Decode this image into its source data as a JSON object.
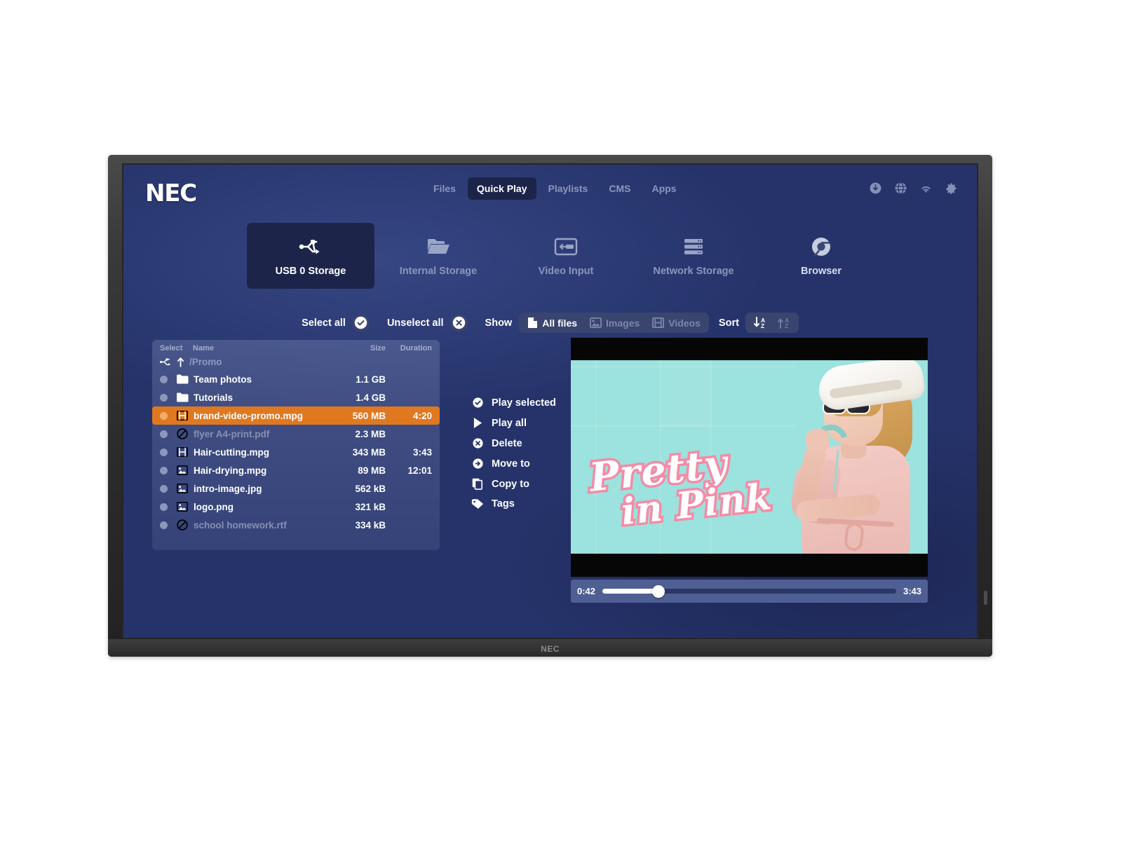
{
  "brand": {
    "logo": "NEC",
    "foot_logo": "NEC"
  },
  "topnav": {
    "items": [
      {
        "label": "Files",
        "active": false
      },
      {
        "label": "Quick Play",
        "active": true
      },
      {
        "label": "Playlists",
        "active": false
      },
      {
        "label": "CMS",
        "active": false
      },
      {
        "label": "Apps",
        "active": false
      }
    ]
  },
  "topicons": [
    {
      "name": "download-icon"
    },
    {
      "name": "globe-icon"
    },
    {
      "name": "wifi-icon"
    },
    {
      "name": "gear-icon"
    }
  ],
  "storage_tabs": [
    {
      "label": "USB 0 Storage",
      "icon": "usb-icon",
      "active": true
    },
    {
      "label": "Internal Storage",
      "icon": "folder-icon",
      "active": false
    },
    {
      "label": "Video Input",
      "icon": "video-input-icon",
      "active": false
    },
    {
      "label": "Network Storage",
      "icon": "server-icon",
      "active": false
    },
    {
      "label": "Browser",
      "icon": "chrome-icon",
      "active": false
    }
  ],
  "toolbar": {
    "select_all": "Select all",
    "unselect_all": "Unselect all",
    "show_label": "Show",
    "filters": [
      {
        "label": "All files",
        "icon": "document-icon",
        "active": true
      },
      {
        "label": "Images",
        "icon": "image-icon",
        "active": false
      },
      {
        "label": "Videos",
        "icon": "film-icon",
        "active": false
      }
    ],
    "sort_label": "Sort",
    "sort_buttons": [
      {
        "name": "sort-descending-az",
        "active": true
      },
      {
        "name": "sort-ascending-az",
        "active": false
      }
    ]
  },
  "filelist": {
    "columns": {
      "select": "Select",
      "name": "Name",
      "size": "Size",
      "duration": "Duration"
    },
    "path": "/Promo",
    "rows": [
      {
        "name": "Team photos",
        "size": "1.1 GB",
        "duration": "",
        "icon": "folder-icon",
        "selected": false,
        "disabled": false
      },
      {
        "name": "Tutorials",
        "size": "1.4 GB",
        "duration": "",
        "icon": "folder-icon",
        "selected": false,
        "disabled": false
      },
      {
        "name": "brand-video-promo.mpg",
        "size": "560 MB",
        "duration": "4:20",
        "icon": "film-icon",
        "selected": true,
        "disabled": false
      },
      {
        "name": "flyer A4-print.pdf",
        "size": "2.3 MB",
        "duration": "",
        "icon": "blocked-icon",
        "selected": false,
        "disabled": true
      },
      {
        "name": "Hair-cutting.mpg",
        "size": "343 MB",
        "duration": "3:43",
        "icon": "film-icon",
        "selected": false,
        "disabled": false
      },
      {
        "name": "Hair-drying.mpg",
        "size": "89 MB",
        "duration": "12:01",
        "icon": "image-icon",
        "selected": false,
        "disabled": false
      },
      {
        "name": "intro-image.jpg",
        "size": "562 kB",
        "duration": "",
        "icon": "image-icon",
        "selected": false,
        "disabled": false
      },
      {
        "name": "logo.png",
        "size": "321 kB",
        "duration": "",
        "icon": "image-icon",
        "selected": false,
        "disabled": false
      },
      {
        "name": "school homework.rtf",
        "size": "334 kB",
        "duration": "",
        "icon": "blocked-icon",
        "selected": false,
        "disabled": true
      }
    ]
  },
  "actions": [
    {
      "label": "Play selected",
      "icon": "check-circle-icon"
    },
    {
      "label": "Play all",
      "icon": "play-icon"
    },
    {
      "label": "Delete",
      "icon": "x-circle-icon"
    },
    {
      "label": "Move to",
      "icon": "arrow-circle-icon"
    },
    {
      "label": "Copy to",
      "icon": "copy-icon"
    },
    {
      "label": "Tags",
      "icon": "tag-icon"
    }
  ],
  "preview": {
    "overlay_line1": "Pretty",
    "overlay_line2": "in Pink",
    "current_time": "0:42",
    "total_time": "3:43",
    "progress_percent": 19
  },
  "colors": {
    "screen_bg": "#26336b",
    "accent_selected": "#e07820",
    "panel": "#1c2549",
    "segment": "#39456f",
    "video_bg": "#9ce2de",
    "script_pink": "#f58ba6"
  }
}
